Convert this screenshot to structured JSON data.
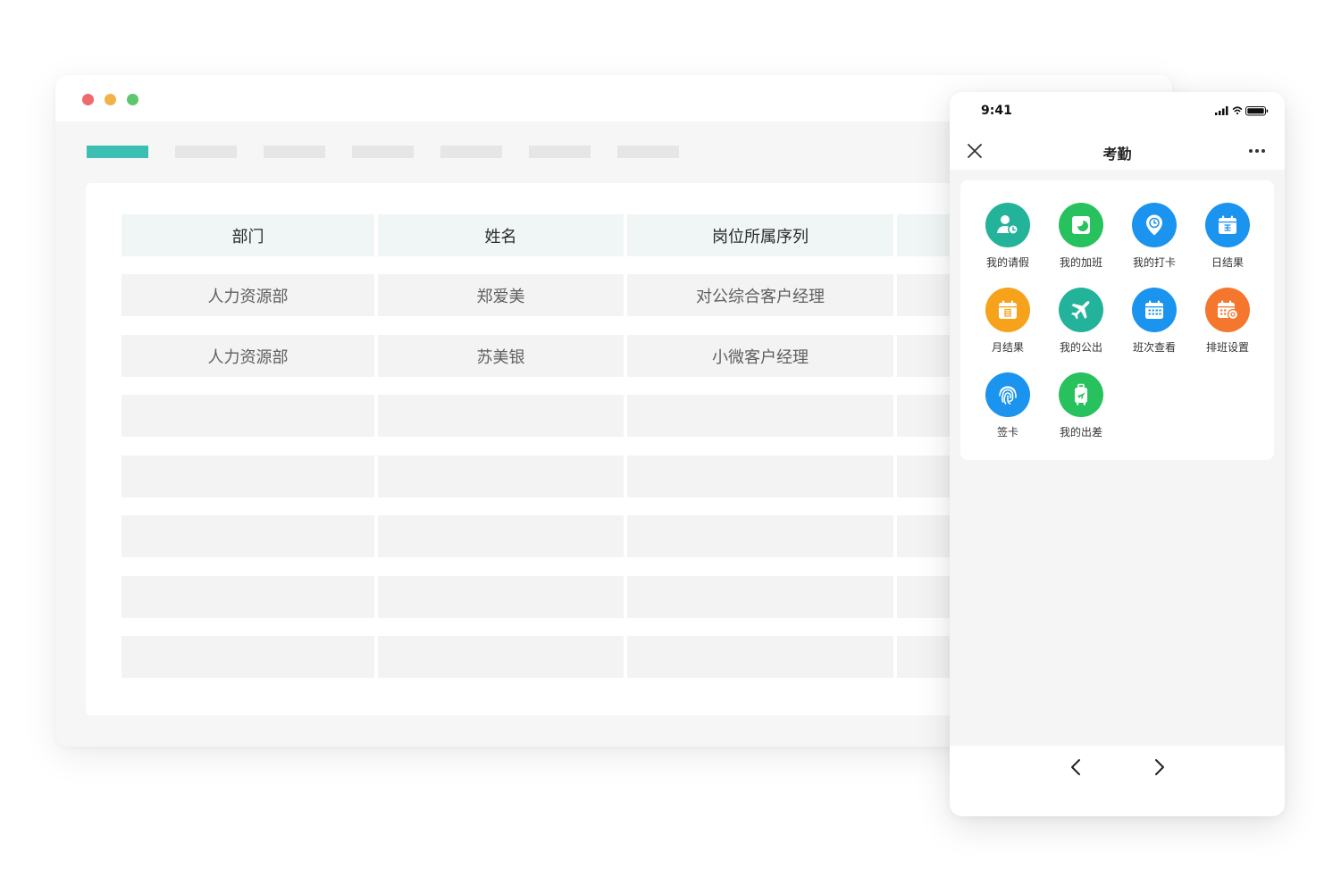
{
  "desktop": {
    "window_dots": [
      "#ef6b6b",
      "#f0b34a",
      "#5dc76e"
    ],
    "tab_accent": "#3bbfb2",
    "table": {
      "headers": [
        "部门",
        "姓名",
        "岗位所属序列"
      ],
      "rows": [
        [
          "人力资源部",
          "郑爱美",
          "对公综合客户经理"
        ],
        [
          "人力资源部",
          "苏美银",
          "小微客户经理"
        ]
      ]
    }
  },
  "phone": {
    "time": "9:41",
    "title": "考勤",
    "apps": [
      {
        "label": "我的请假",
        "icon": "person-clock-icon",
        "color": "#22b39a"
      },
      {
        "label": "我的加班",
        "icon": "moon-icon",
        "color": "#27c15e"
      },
      {
        "label": "我的打卡",
        "icon": "location-clock-icon",
        "color": "#1a94ee"
      },
      {
        "label": "日结果",
        "icon": "calendar-icon",
        "color": "#1a94ee"
      },
      {
        "label": "月结果",
        "icon": "calendar-month-icon",
        "color": "#f7a21b"
      },
      {
        "label": "我的公出",
        "icon": "airplane-icon",
        "color": "#22b39a"
      },
      {
        "label": "班次查看",
        "icon": "calendar-grid-icon",
        "color": "#1a94ee"
      },
      {
        "label": "排班设置",
        "icon": "calendar-gear-icon",
        "color": "#f4772d"
      },
      {
        "label": "签卡",
        "icon": "fingerprint-icon",
        "color": "#1a94ee"
      },
      {
        "label": "我的出差",
        "icon": "luggage-icon",
        "color": "#27c15e"
      }
    ]
  }
}
